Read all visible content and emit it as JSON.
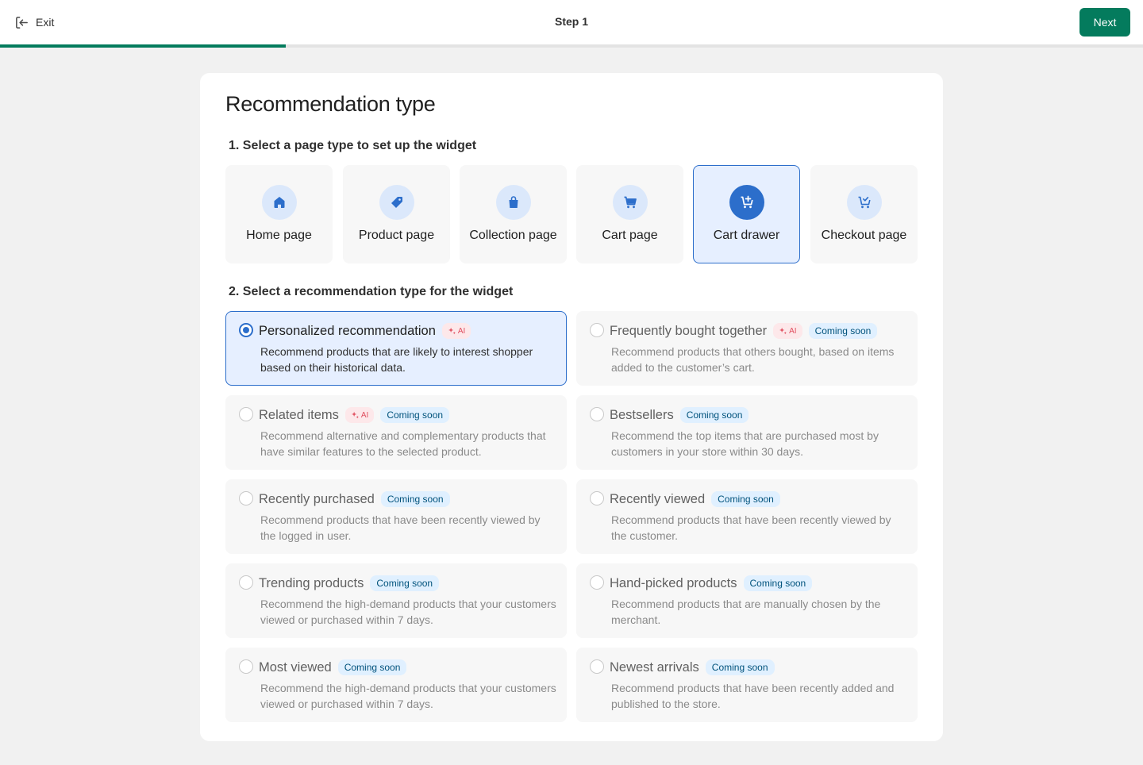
{
  "topbar": {
    "exit_label": "Exit",
    "step_title": "Step 1",
    "next_label": "Next",
    "progress_percent": 25,
    "accent_color": "#047b5d"
  },
  "card": {
    "title": "Recommendation type",
    "section1_label": "1. Select a page type to set up the widget",
    "section2_label": "2. Select a recommendation type for the widget"
  },
  "page_types": [
    {
      "label": "Home page",
      "icon": "home-icon",
      "selected": false
    },
    {
      "label": "Product page",
      "icon": "tag-icon",
      "selected": false
    },
    {
      "label": "Collection page",
      "icon": "shopping-bag-icon",
      "selected": false
    },
    {
      "label": "Cart page",
      "icon": "cart-icon",
      "selected": false
    },
    {
      "label": "Cart drawer",
      "icon": "cart-plus-icon",
      "selected": true
    },
    {
      "label": "Checkout page",
      "icon": "cart-check-icon",
      "selected": false
    }
  ],
  "recommendations": [
    {
      "title": "Personalized recommendation",
      "ai_label": "AI",
      "soon_label": "",
      "description": "Recommend products that are likely to interest shopper based on their historical data.",
      "selected": true
    },
    {
      "title": "Frequently bought together",
      "ai_label": "AI",
      "soon_label": "Coming soon",
      "description": "Recommend products that others bought, based on items added to the customer’s cart.",
      "selected": false
    },
    {
      "title": "Related items",
      "ai_label": "AI",
      "soon_label": "Coming soon",
      "description": "Recommend alternative and complementary products that have similar features to the selected product.",
      "selected": false
    },
    {
      "title": "Bestsellers",
      "ai_label": "",
      "soon_label": "Coming soon",
      "description": "Recommend the top items that are purchased most by customers in your store within 30 days.",
      "selected": false
    },
    {
      "title": "Recently purchased",
      "ai_label": "",
      "soon_label": "Coming soon",
      "description": "Recommend products that have been recently viewed by the logged in user.",
      "selected": false
    },
    {
      "title": "Recently viewed",
      "ai_label": "",
      "soon_label": "Coming soon",
      "description": "Recommend products that have been recently viewed by the customer.",
      "selected": false
    },
    {
      "title": "Trending products",
      "ai_label": "",
      "soon_label": "Coming soon",
      "description": "Recommend the high-demand products that your customers viewed or purchased within 7 days.",
      "selected": false
    },
    {
      "title": "Hand-picked products",
      "ai_label": "",
      "soon_label": "Coming soon",
      "description": "Recommend products that are manually chosen by the merchant.",
      "selected": false
    },
    {
      "title": "Most viewed",
      "ai_label": "",
      "soon_label": "Coming soon",
      "description": "Recommend the high-demand products that your customers viewed or purchased within 7 days.",
      "selected": false
    },
    {
      "title": "Newest arrivals",
      "ai_label": "",
      "soon_label": "Coming soon",
      "description": "Recommend products that have been recently added and published to the store.",
      "selected": false
    }
  ]
}
